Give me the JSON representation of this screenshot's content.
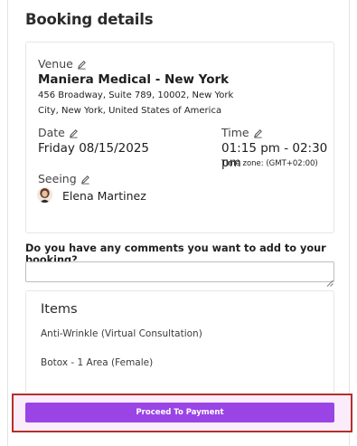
{
  "header": {
    "title": "Booking details"
  },
  "booking": {
    "venue_label": "Venue",
    "venue_name": "Maniera Medical - New York",
    "address_line1": "456 Broadway, Suite 789, 10002, New York",
    "address_line2": "City, New York, United States of America",
    "date_label": "Date",
    "date_value": "Friday 08/15/2025",
    "time_label": "Time",
    "time_value": "01:15 pm - 02:30 pm",
    "timezone": "Time zone: (GMT+02:00)",
    "seeing_label": "Seeing",
    "practitioner": "Elena Martinez"
  },
  "comments": {
    "question": "Do you have any comments you want to add to your booking?",
    "value": "",
    "placeholder": ""
  },
  "items": {
    "title": "Items",
    "list": [
      "Anti-Wrinkle (Virtual Consultation)",
      "Botox - 1 Area (Female)"
    ]
  },
  "footer": {
    "pay_button": "Proceed To Payment"
  },
  "colors": {
    "accent": "#9a44e6",
    "highlight_border": "#b3302a",
    "highlight_fill": "#fbecfb"
  },
  "icons": {
    "edit": "pencil-icon",
    "resize": "resize-grip-icon"
  }
}
